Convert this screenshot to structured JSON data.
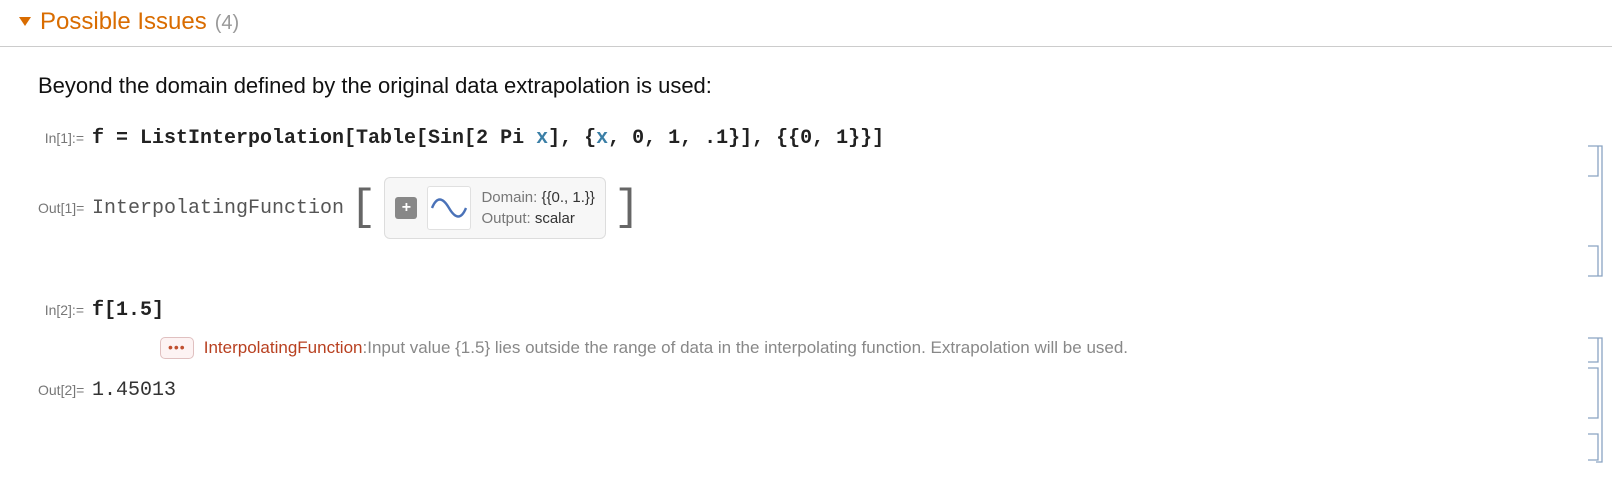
{
  "section": {
    "title": "Possible Issues",
    "count": "(4)"
  },
  "description": "Beyond the domain defined by the original data extrapolation is used:",
  "cells": {
    "in1": {
      "label": "In[1]:=",
      "code_prefix": "f = ListInterpolation[Table[Sin[2 Pi ",
      "code_var": "x",
      "code_mid": "], {",
      "code_var2": "x",
      "code_suffix": ", 0, 1, .1}], {{0, 1}}]"
    },
    "out1": {
      "label": "Out[1]=",
      "head": "InterpolatingFunction",
      "domain_k": "Domain:",
      "domain_v": "{{0., 1.}}",
      "output_k": "Output:",
      "output_v": "scalar"
    },
    "in2": {
      "label": "In[2]:=",
      "code": "f[1.5]"
    },
    "msg": {
      "dots": "•••",
      "head": "InterpolatingFunction",
      "colon": ": ",
      "body": "Input value {1.5} lies outside the range of data in the interpolating function. Extrapolation will be used."
    },
    "out2": {
      "label": "Out[2]=",
      "value": "1.45013"
    }
  }
}
